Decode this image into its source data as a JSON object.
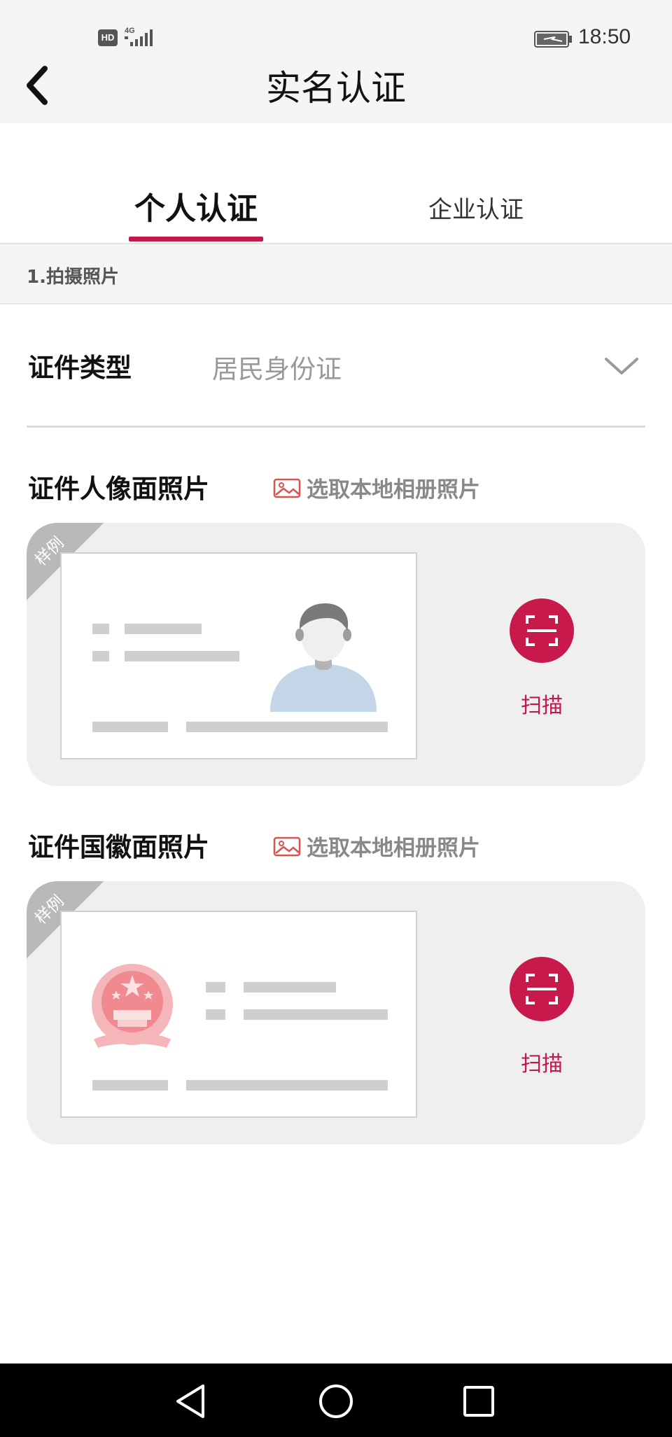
{
  "status_bar": {
    "hd": "HD",
    "network": "4G",
    "time": "18:50"
  },
  "header": {
    "title": "实名认证"
  },
  "tabs": [
    {
      "label": "个人认证",
      "active": true
    },
    {
      "label": "企业认证",
      "active": false
    }
  ],
  "colors": {
    "accent": "#c1184a",
    "scan_button": "#c8194c",
    "background": "#f5f5f5"
  },
  "section": {
    "heading": "1.拍摄照片"
  },
  "id_type": {
    "label": "证件类型",
    "value": "居民身份证"
  },
  "portrait_side": {
    "title": "证件人像面照片",
    "album_link": "选取本地相册照片",
    "sample_tag": "样例",
    "scan_label": "扫描"
  },
  "emblem_side": {
    "title": "证件国徽面照片",
    "album_link": "选取本地相册照片",
    "sample_tag": "样例",
    "scan_label": "扫描"
  },
  "icons": [
    "back-arrow-icon",
    "chevron-down-icon",
    "picture-icon",
    "scan-icon",
    "avatar-icon",
    "national-emblem-icon",
    "nav-back-icon",
    "nav-home-icon",
    "nav-recents-icon"
  ]
}
